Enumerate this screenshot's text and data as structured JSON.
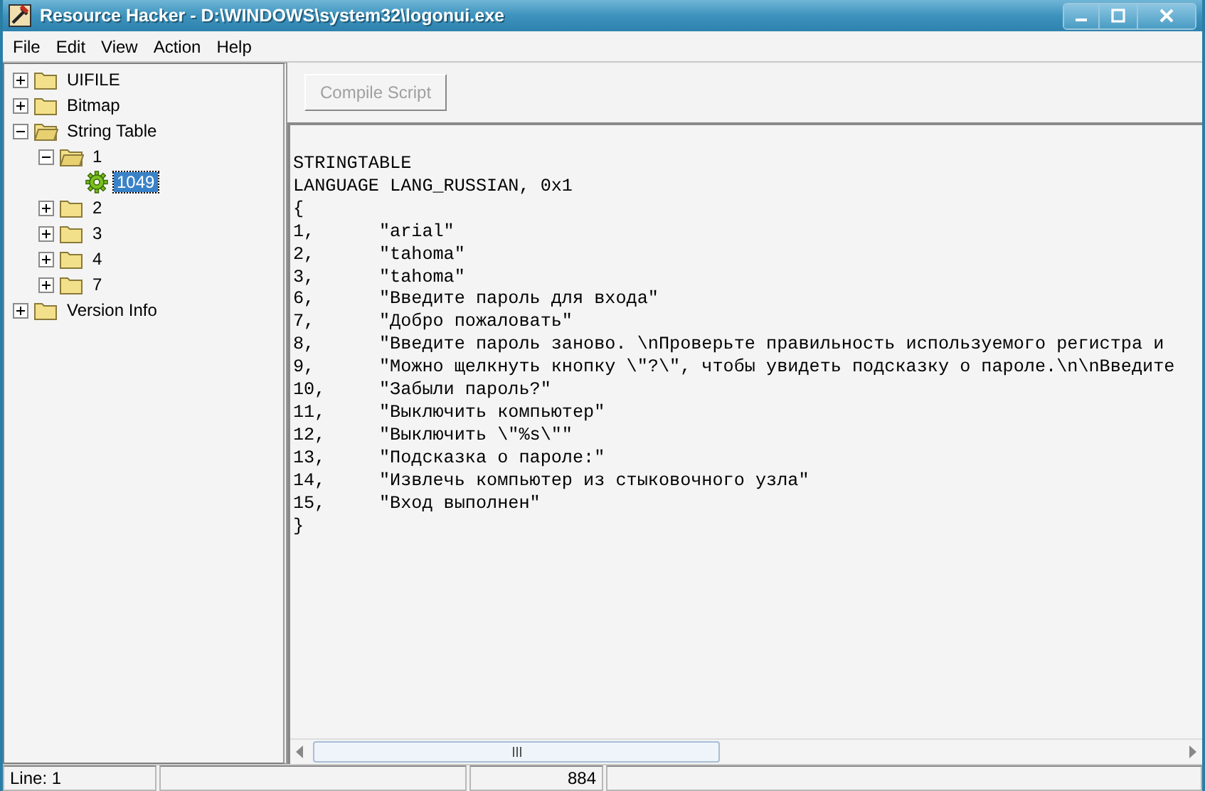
{
  "window": {
    "title": "Resource Hacker  -  D:\\WINDOWS\\system32\\logonui.exe"
  },
  "menu": [
    "File",
    "Edit",
    "View",
    "Action",
    "Help"
  ],
  "tree": [
    {
      "label": "UIFILE",
      "kind": "folder",
      "expanded": false,
      "selected": false
    },
    {
      "label": "Bitmap",
      "kind": "folder",
      "expanded": false,
      "selected": false
    },
    {
      "label": "String Table",
      "kind": "folder",
      "expanded": true,
      "selected": false,
      "children": [
        {
          "label": "1",
          "kind": "folder",
          "expanded": true,
          "selected": false,
          "children": [
            {
              "label": "1049",
              "kind": "resource",
              "selected": true
            }
          ]
        },
        {
          "label": "2",
          "kind": "folder",
          "expanded": false,
          "selected": false
        },
        {
          "label": "3",
          "kind": "folder",
          "expanded": false,
          "selected": false
        },
        {
          "label": "4",
          "kind": "folder",
          "expanded": false,
          "selected": false
        },
        {
          "label": "7",
          "kind": "folder",
          "expanded": false,
          "selected": false
        }
      ]
    },
    {
      "label": "Version Info",
      "kind": "folder",
      "expanded": false,
      "selected": false
    }
  ],
  "compile_button": {
    "label": "Compile Script",
    "disabled": true
  },
  "script_lines": [
    "STRINGTABLE",
    "LANGUAGE LANG_RUSSIAN, 0x1",
    "{",
    "1,      \"arial\"",
    "2,      \"tahoma\"",
    "3,      \"tahoma\"",
    "6,      \"Введите пароль для входа\"",
    "7,      \"Добро пожаловать\"",
    "8,      \"Введите пароль заново. \\nПроверьте правильность используемого регистра и",
    "9,      \"Можно щелкнуть кнопку \\\"?\\\", чтобы увидеть подсказку о пароле.\\n\\nВведите",
    "10,     \"Забыли пароль?\"",
    "11,     \"Выключить компьютер\"",
    "12,     \"Выключить \\\"%s\\\"\"",
    "13,     \"Подсказка о пароле:\"",
    "14,     \"Извлечь компьютер из стыковочного узла\"",
    "15,     \"Вход выполнен\"",
    "}"
  ],
  "status_bar": {
    "line": "Line: 1",
    "size": "884"
  }
}
